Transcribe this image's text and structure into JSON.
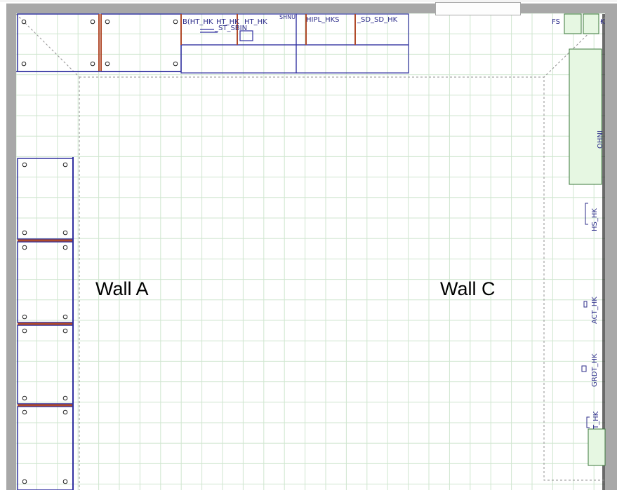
{
  "app": {
    "view": "Kitchen floor plan (top view)"
  },
  "walls": {
    "wall_a_label": "Wall A",
    "wall_c_label": "Wall C"
  },
  "top_cabinets": [
    {
      "code": "B(HT_HK"
    },
    {
      "code": "HT_HK"
    },
    {
      "code": "HT_HK"
    },
    {
      "code": "_ST_SBIN"
    },
    {
      "code": "HIPL_HKS"
    },
    {
      "code": "_SD_SD_HK"
    },
    {
      "code": "SHNU"
    }
  ],
  "right_labels": [
    {
      "code": "FS"
    },
    {
      "code": "K"
    },
    {
      "code": "OHNI"
    },
    {
      "code": "HS_HK"
    },
    {
      "code": "ACT_HK"
    },
    {
      "code": "GRDT_HK"
    },
    {
      "code": "T_HK"
    }
  ],
  "colors": {
    "grid": "#cfe6cf",
    "wall": "#a8a8a8",
    "cabinet_outline": "#3030a0",
    "cabinet_edge": "#b04a2a",
    "appliance_fill": "#e6f7e2",
    "appliance_stroke": "#3c7a3c",
    "dashed": "#909090"
  }
}
